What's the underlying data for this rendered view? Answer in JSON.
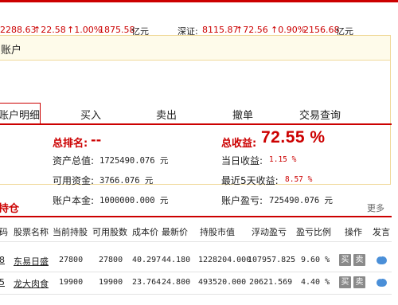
{
  "ticker": {
    "sh_value": "2288.63",
    "sh_change": "↑22.58",
    "sh_pct": "↑1.00%",
    "sh_amount": "1875.58",
    "sh_unit": "亿元",
    "sz_label": "深证:",
    "sz_value": "8115.87",
    "sz_change": "↑72.56",
    "sz_pct": "↑0.90%",
    "sz_amount": "2156.68",
    "sz_unit": "亿元"
  },
  "account": {
    "title": "账户",
    "tabs": [
      "账户明细",
      "买入",
      "卖出",
      "撤单",
      "交易查询"
    ],
    "rank_label": "总排名:",
    "rank_value": "--",
    "total_assets_label": "资产总值:",
    "total_assets_value": "1725490.076 元",
    "available_label": "可用资金:",
    "available_value": "3766.076 元",
    "principal_label": "账户本金:",
    "principal_value": "1000000.000 元",
    "total_return_label": "总收益:",
    "total_return_value": "72.55 %",
    "daily_return_label": "当日收益:",
    "daily_return_value": "1.15 %",
    "five_day_label": "最近5天收益:",
    "five_day_value": "8.57 %",
    "pnl_label": "账户盈亏:",
    "pnl_value": "725490.076 元"
  },
  "holdings": {
    "title": "持仓",
    "more": "更多",
    "columns": [
      "码",
      "股票名称",
      "当前持股",
      "可用股数",
      "成本价",
      "最新价",
      "持股市值",
      "浮动盈亏",
      "盈亏比例",
      "操作",
      "发言"
    ],
    "rows": [
      {
        "code": "8",
        "name": "东易日盛",
        "current": "27800",
        "available": "27800",
        "cost": "40.297",
        "latest": "44.180",
        "value": "1228204.000",
        "pnl": "107957.825",
        "ratio": "9.60 %",
        "buy": "买",
        "sell": "卖"
      },
      {
        "code": "5",
        "name": "龙大肉食",
        "current": "19900",
        "available": "19900",
        "cost": "23.764",
        "latest": "24.800",
        "value": "493520.000",
        "pnl": "20621.569",
        "ratio": "4.40 %",
        "buy": "买",
        "sell": "卖"
      }
    ]
  },
  "colors": {
    "accent": "#cc0000",
    "box_border": "#f0d99a",
    "box_header_bg": "#fefbea",
    "button_gray": "#8a8a8a",
    "comment_blue": "#4a8fd8"
  }
}
